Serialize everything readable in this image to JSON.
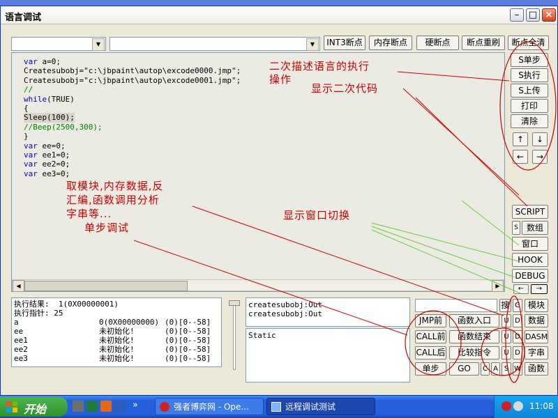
{
  "window": {
    "title": "语言调试"
  },
  "toolbar": {
    "combo1_value": "",
    "combo2_value": "",
    "buttons": [
      "INT3断点",
      "内存断点",
      "硬断点",
      "断点重刷",
      "断点全清"
    ]
  },
  "code_lines": [
    {
      "t": "var a=0;",
      "c": "kw"
    },
    {
      "t": "Createsubobj=\"c:\\jbpaint\\autop\\excode0000.jmp\";",
      "c": ""
    },
    {
      "t": "Createsubobj=\"c:\\jbpaint\\autop\\excode0001.jmp\";",
      "c": ""
    },
    {
      "t": "//",
      "c": "cm"
    },
    {
      "t": "while(TRUE)",
      "c": "kw"
    },
    {
      "t": "{",
      "c": ""
    },
    {
      "t": "Sleep(100);",
      "c": "hl"
    },
    {
      "t": "//Beep(2500,300);",
      "c": "cm"
    },
    {
      "t": "}",
      "c": ""
    },
    {
      "t": "var ee=0;",
      "c": "kw"
    },
    {
      "t": "var ee1=0;",
      "c": "kw"
    },
    {
      "t": "var ee2=0;",
      "c": "kw"
    },
    {
      "t": "var ee3=0;",
      "c": "kw"
    }
  ],
  "right_buttons": [
    "S单步",
    "S执行",
    "S上传",
    "打印",
    "清除"
  ],
  "arrows": {
    "up": "↑",
    "down": "↓",
    "left": "←",
    "right": "→"
  },
  "view_buttons": {
    "script": "SCRIPT",
    "array": "数组",
    "window": "窗口",
    "hook": "HOOK",
    "debug": "DEBUG",
    "s_box": "S"
  },
  "annotations": {
    "a1_line1": "二次描述语言的执行",
    "a1_line2": "操作",
    "a2": "显示二次代码",
    "a3_line1": "取模块,内存数据,反",
    "a3_line2": "汇编,函数调用分析",
    "a3_line3": "字串等...",
    "a4": "单步调试",
    "a5": "显示窗口切换"
  },
  "vars_panel": {
    "result": "执行结果:  1(0X00000001)",
    "pointer": "执行指针: 25",
    "rows": [
      {
        "name": "a",
        "value": "0(0X00000000)",
        "extra": "(0)[0--58]"
      },
      {
        "name": "ee",
        "value": "未初始化!",
        "extra": "(0)[0--58]"
      },
      {
        "name": "ee1",
        "value": "未初始化!",
        "extra": "(0)[0--58]"
      },
      {
        "name": "ee2",
        "value": "未初始化!",
        "extra": "(0)[0--58]"
      },
      {
        "name": "ee3",
        "value": "未初始化!",
        "extra": "(0)[0--58]"
      }
    ]
  },
  "output_lines": [
    "createsubobj:Out",
    "createsubobj:Out"
  ],
  "static_text": "Static",
  "bottom_grid": {
    "search": "搜",
    "g": "G",
    "module": "模块",
    "jmp": "JMP前",
    "func_entry": "函数入口",
    "u1": "U",
    "d1": "D",
    "data": "数据",
    "call_before": "CALL前",
    "func_end": "函数结束",
    "u2": "U",
    "d2": "D",
    "dasm": "DASM",
    "call_after": "CALL后",
    "compare": "比较指令",
    "u3": "U",
    "d3": "D",
    "string": "字串",
    "step": "单步",
    "go": "GO",
    "c": "C",
    "a": "A",
    "s": "S",
    "w": "W",
    "function": "函数"
  },
  "taskbar": {
    "start": "开始",
    "expand": "»",
    "task1": "强者博弈网 - Ope...",
    "task2": "远程调试测试",
    "time": "11:08"
  },
  "colors": {
    "annotation": "#cc0000",
    "keyword": "#0000c0",
    "comment": "#008000",
    "accent_line": "#66cc33"
  }
}
